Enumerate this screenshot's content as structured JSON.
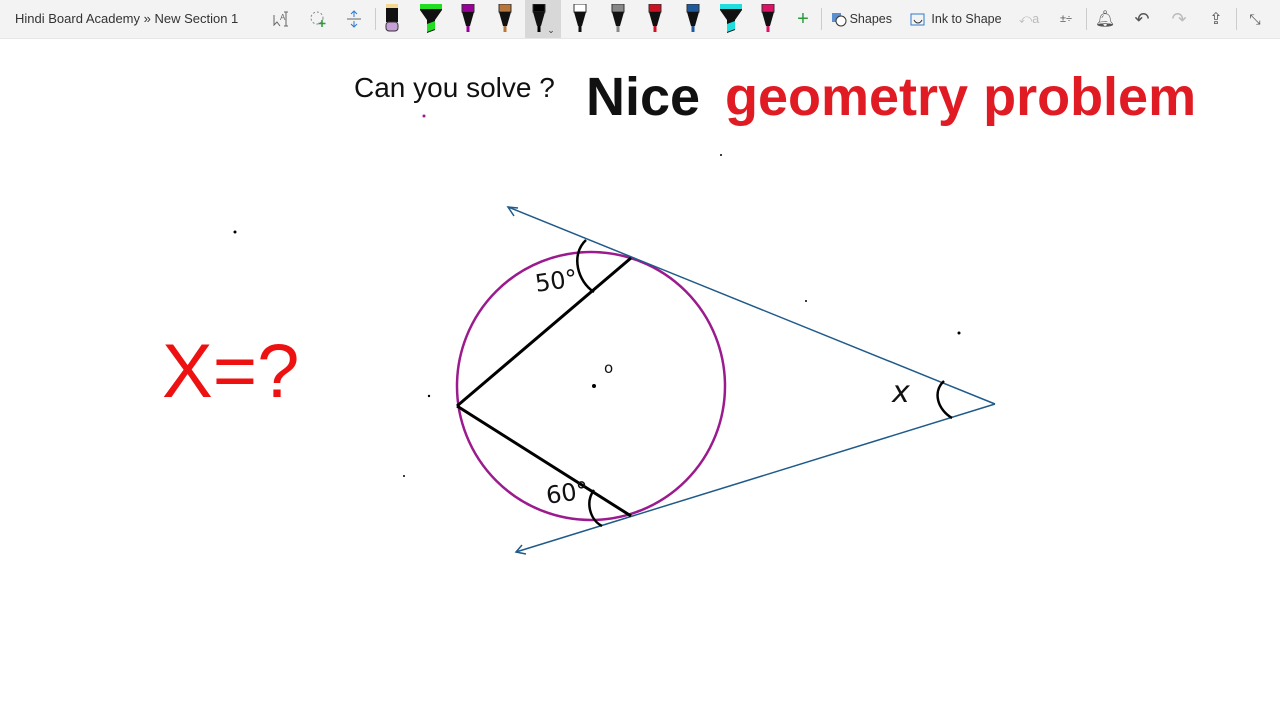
{
  "toolbar": {
    "breadcrumb": "Hindi Board Academy » New Section 1",
    "shapes_label": "Shapes",
    "ink_to_shape_label": "Ink to Shape",
    "pens": [
      {
        "type": "pen",
        "color": "#000000",
        "cap": "#c8a0d8"
      },
      {
        "type": "highlighter",
        "color": "#22dd22"
      },
      {
        "type": "pen",
        "color": "#990099"
      },
      {
        "type": "pencil",
        "color": "#b8773a"
      },
      {
        "type": "pen",
        "color": "#000000",
        "selected": true
      },
      {
        "type": "pen",
        "color": "#ffffff"
      },
      {
        "type": "pencil",
        "color": "#888888"
      },
      {
        "type": "pen",
        "color": "#cc1122"
      },
      {
        "type": "pen",
        "color": "#1f5a9a"
      },
      {
        "type": "highlighter",
        "color": "#22dddd"
      },
      {
        "type": "pen",
        "color": "#dd1166"
      }
    ]
  },
  "page": {
    "question": "Can you solve ?",
    "title_black": "Nice",
    "title_red": "geometry problem",
    "prompt": "X=?",
    "angle_top": "50°",
    "angle_bottom": "60°",
    "angle_x": "x",
    "center_mark": "o"
  },
  "colors": {
    "accent_red": "#e01b24",
    "circle": "#9b1a8e",
    "tangent": "#1f5a8a"
  }
}
